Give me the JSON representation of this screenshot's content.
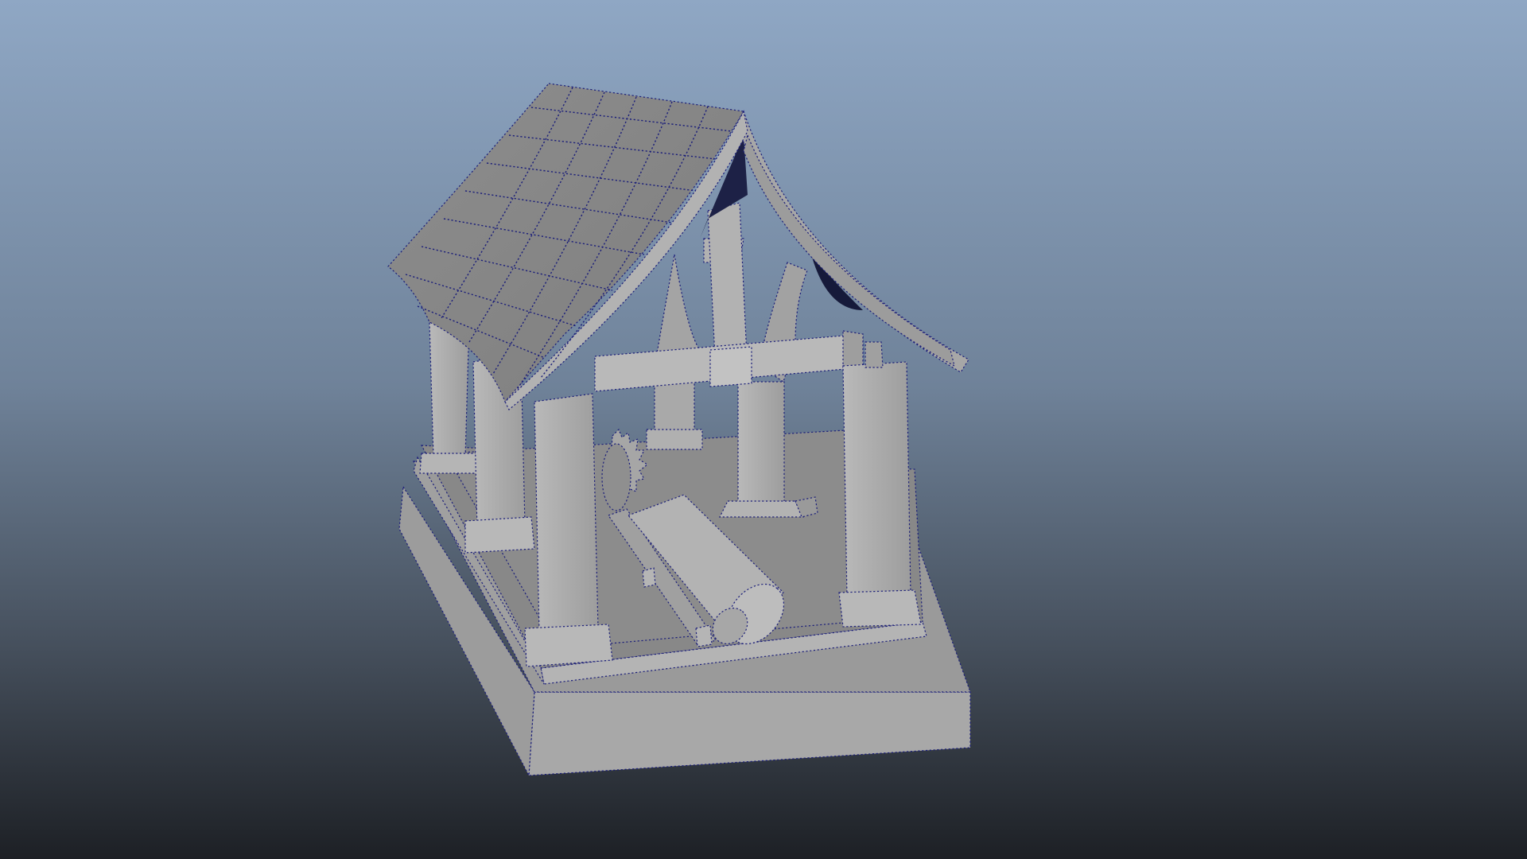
{
  "viewport": {
    "background_top": "#8fa7c4",
    "background_bottom": "#1d2025"
  },
  "model": {
    "shading": "gray",
    "wireframe_color": "#1c1f7a",
    "base_color": "#a9a9a9",
    "roof_color": "#8f8f8f",
    "shadow_color": "#6f6f6f",
    "underside_color": "#161a3a"
  }
}
